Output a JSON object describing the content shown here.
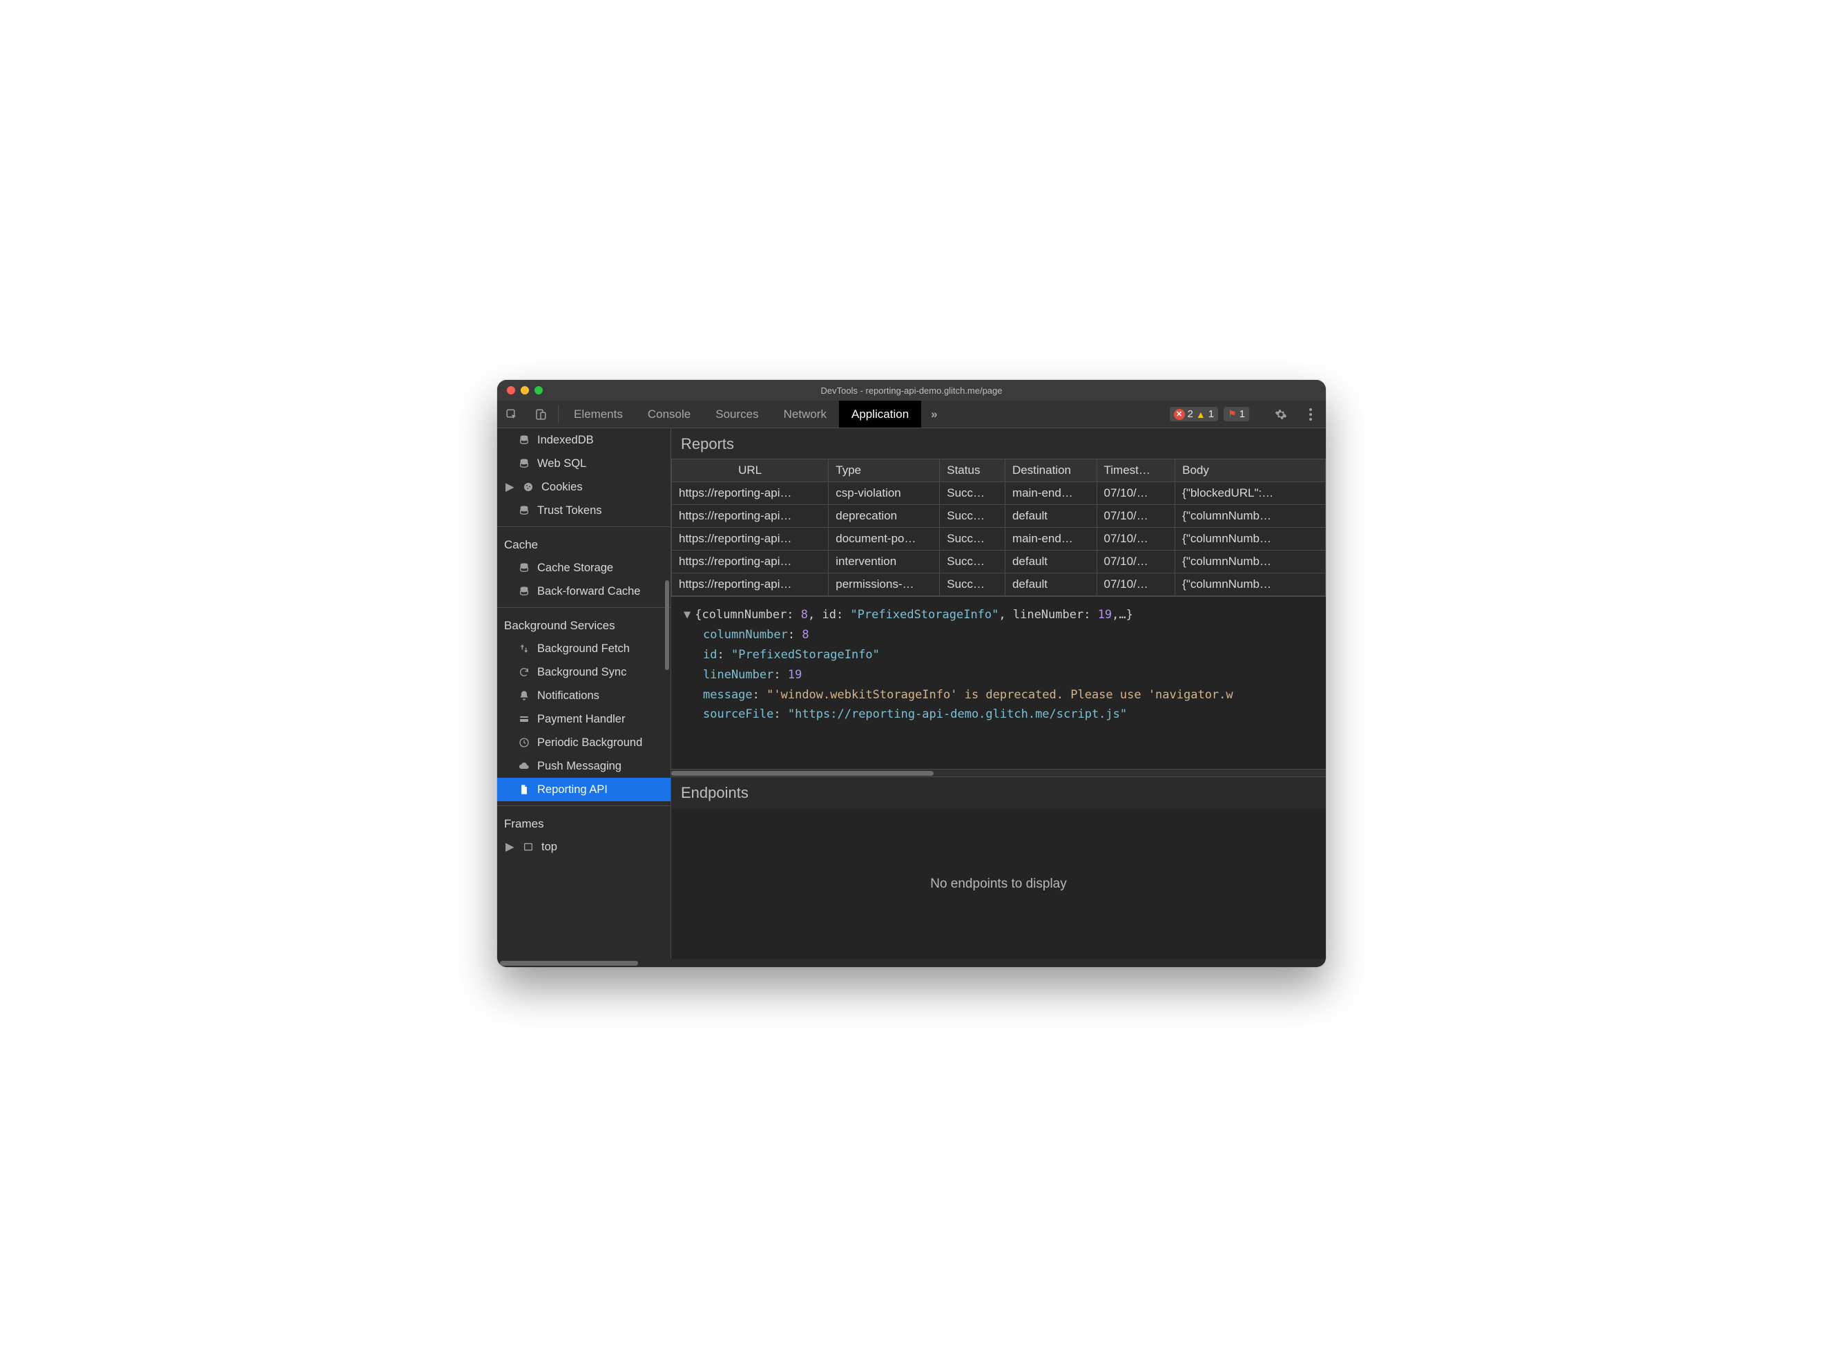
{
  "window_title": "DevTools - reporting-api-demo.glitch.me/page",
  "toolbar": {
    "tabs": [
      "Elements",
      "Console",
      "Sources",
      "Network",
      "Application"
    ],
    "active_tab": "Application",
    "more": "»",
    "errors": "2",
    "warnings": "1",
    "issues": "1"
  },
  "sidebar": {
    "storage_items": [
      {
        "label": "IndexedDB",
        "icon": "db"
      },
      {
        "label": "Web SQL",
        "icon": "db"
      },
      {
        "label": "Cookies",
        "icon": "cookie",
        "expandable": true
      },
      {
        "label": "Trust Tokens",
        "icon": "db"
      }
    ],
    "cache_label": "Cache",
    "cache_items": [
      {
        "label": "Cache Storage",
        "icon": "db"
      },
      {
        "label": "Back-forward Cache",
        "icon": "db"
      }
    ],
    "bg_label": "Background Services",
    "bg_items": [
      {
        "label": "Background Fetch",
        "icon": "updown"
      },
      {
        "label": "Background Sync",
        "icon": "sync"
      },
      {
        "label": "Notifications",
        "icon": "bell"
      },
      {
        "label": "Payment Handler",
        "icon": "card"
      },
      {
        "label": "Periodic Background",
        "icon": "clock"
      },
      {
        "label": "Push Messaging",
        "icon": "cloud"
      },
      {
        "label": "Reporting API",
        "icon": "page",
        "selected": true
      }
    ],
    "frames_label": "Frames",
    "frames_items": [
      {
        "label": "top",
        "icon": "frame",
        "expandable": true
      }
    ]
  },
  "reports": {
    "title": "Reports",
    "headers": [
      "URL",
      "Type",
      "Status",
      "Destination",
      "Timest…",
      "Body"
    ],
    "rows": [
      {
        "url": "https://reporting-api…",
        "type": "csp-violation",
        "status": "Succ…",
        "dest": "main-end…",
        "ts": "07/10/…",
        "body": "{\"blockedURL\":…"
      },
      {
        "url": "https://reporting-api…",
        "type": "deprecation",
        "status": "Succ…",
        "dest": "default",
        "ts": "07/10/…",
        "body": "{\"columnNumb…"
      },
      {
        "url": "https://reporting-api…",
        "type": "document-po…",
        "status": "Succ…",
        "dest": "main-end…",
        "ts": "07/10/…",
        "body": "{\"columnNumb…"
      },
      {
        "url": "https://reporting-api…",
        "type": "intervention",
        "status": "Succ…",
        "dest": "default",
        "ts": "07/10/…",
        "body": "{\"columnNumb…"
      },
      {
        "url": "https://reporting-api…",
        "type": "permissions-…",
        "status": "Succ…",
        "dest": "default",
        "ts": "07/10/…",
        "body": "{\"columnNumb…"
      }
    ]
  },
  "detail": {
    "summary_prefix": "{columnNumber: ",
    "summary_col": "8",
    "summary_mid": ", id: ",
    "summary_id": "\"PrefixedStorageInfo\"",
    "summary_mid2": ", lineNumber: ",
    "summary_line": "19",
    "summary_suffix": ",…}",
    "k_columnNumber": "columnNumber",
    "v_columnNumber": "8",
    "k_id": "id",
    "v_id": "\"PrefixedStorageInfo\"",
    "k_lineNumber": "lineNumber",
    "v_lineNumber": "19",
    "k_message": "message",
    "v_message": "\"'window.webkitStorageInfo' is deprecated. Please use 'navigator.w",
    "k_sourceFile": "sourceFile",
    "v_sourceFile": "\"https://reporting-api-demo.glitch.me/script.js\""
  },
  "endpoints": {
    "title": "Endpoints",
    "empty": "No endpoints to display"
  }
}
